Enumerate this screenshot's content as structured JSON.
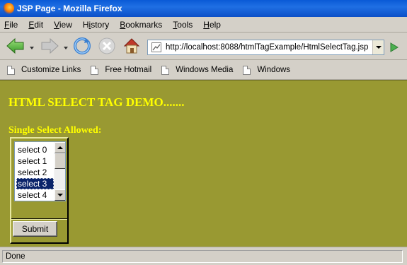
{
  "window": {
    "title": "JSP Page - Mozilla Firefox"
  },
  "menu": {
    "items": [
      {
        "key": "F",
        "rest": "ile"
      },
      {
        "key": "E",
        "rest": "dit"
      },
      {
        "key": "V",
        "rest": "iew"
      },
      {
        "key": "",
        "rest": "History",
        "underline_index": 1
      },
      {
        "key": "B",
        "rest": "ookmarks"
      },
      {
        "key": "T",
        "rest": "ools"
      },
      {
        "key": "H",
        "rest": "elp"
      }
    ]
  },
  "navigation": {
    "url": "http://localhost:8088/htmlTagExample/HtmlSelectTag.jsp",
    "icons": [
      "back-icon",
      "forward-icon",
      "reload-icon",
      "stop-icon",
      "home-icon",
      "go-icon"
    ]
  },
  "bookmarks": {
    "items": [
      "Customize Links",
      "Free Hotmail",
      "Windows Media",
      "Windows"
    ]
  },
  "page": {
    "heading": "HTML SELECT TAG DEMO.......",
    "label": "Single Select Allowed:",
    "select_options": [
      "select 0",
      "select 1",
      "select 2",
      "select 3",
      "select 4"
    ],
    "selected_option": "select 3",
    "submit_label": "Submit",
    "background_color": "#999932",
    "text_color": "#ffff00"
  },
  "status": {
    "text": "Done"
  }
}
